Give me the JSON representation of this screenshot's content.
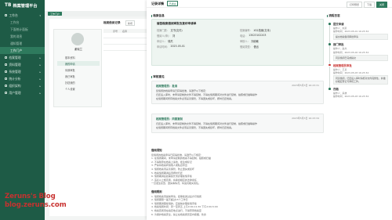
{
  "app": {
    "title": "档案管理平台",
    "logo_mark": "TB"
  },
  "sidebar": {
    "items": [
      {
        "label": "工作台",
        "icon": "home-icon",
        "level": 0,
        "chevron": "▾"
      },
      {
        "label": "工作台",
        "icon": "",
        "level": 1
      },
      {
        "label": "下面统计面板",
        "icon": "",
        "level": 1
      },
      {
        "label": "我的消息",
        "icon": "",
        "level": 1
      },
      {
        "label": "通知管理",
        "icon": "",
        "level": 1
      },
      {
        "label": "工作门户",
        "icon": "",
        "level": 1,
        "active": true
      },
      {
        "label": "档案管理",
        "icon": "folder-icon",
        "level": 0,
        "chevron": "▸"
      },
      {
        "label": "资料管理",
        "icon": "file-icon",
        "level": 0,
        "chevron": "▸"
      },
      {
        "label": "系统管理",
        "icon": "gear-icon",
        "level": 0,
        "chevron": "▸"
      },
      {
        "label": "统计分析",
        "icon": "chart-icon",
        "level": 0,
        "chevron": "▸"
      },
      {
        "label": "组织架构",
        "icon": "org-icon",
        "level": 0,
        "chevron": "▸"
      },
      {
        "label": "用户管理",
        "icon": "user-icon",
        "level": 0,
        "chevron": "▸"
      }
    ]
  },
  "tabs": {
    "active": "工作门户"
  },
  "background_page": {
    "user_name": "谢晓兰",
    "list_title": "档案借阅记录",
    "action_label": "新增",
    "tree": [
      "基本资料",
      "我的申请",
      "待我审批",
      "我已审批",
      "抄送我的",
      "个人设置"
    ],
    "columns": [
      "序号",
      "名称"
    ]
  },
  "drawer": {
    "title": "记录详情",
    "badge": "已通过",
    "buttons": {
      "print": "打印预览",
      "download": "下载",
      "close": "关闭"
    },
    "basic_section": "档案信息",
    "basic_title": "催告档案借阅审批及复印申请单",
    "fields": [
      {
        "k": "档案门类：",
        "v": "文书(文件)"
      },
      {
        "k": "档案编号：",
        "v": "XS1档案(文本)"
      },
      {
        "k": "借阅人(申)：",
        "v": "刘"
      },
      {
        "k": "电话：",
        "v": "13023102203"
      },
      {
        "k": "申请人：",
        "v": "徐杰"
      },
      {
        "k": "审核人：",
        "v": "刘增敏"
      },
      {
        "k": "申请时间：",
        "v": "2023-05-01"
      },
      {
        "k": "借阅类型：",
        "v": "借出"
      }
    ],
    "approval_section": "审核意见",
    "ops": [
      {
        "node": "档案管理员：",
        "result": "批准",
        "time": "2023年5月3日 16:23:31",
        "lines": [
          "您借阅的档案申请已获得批准，请遵守以下规定：",
          "归还后入库时，未申请复制的文件不得复制，不得在借阅期间对文件进行复制、拍照或扫描等操作",
          "在借阅期间所有档案文件必须妥善保管，不得遗失或损坏，按时归还档案。"
        ]
      },
      {
        "node": "档案管理员：",
        "result": "同意复制",
        "time": "2023年5月3日 16:23:34",
        "lines": [
          "归还后入库时，未申请复制的文件不得复制，不得在借阅期间对文件进行复制、拍照或扫描等操作",
          "在借阅期间所有档案文件必须妥善保管，不得遗失或损坏，按时归还档案。"
        ]
      }
    ],
    "notice_title": "借阅须知",
    "notice_lines": [
      "您借阅的档案申请已获得批准，请遵守以下规定：",
      "1. 在借阅期间，未申请复制的档案不得复制、拍照或扫描",
      "2. 不得随意在档案上涂改、批注或标记",
      "3. 严禁将档案转借他人或私自带出",
      "4. 借阅档案须妥善保管，防止遗失或损坏",
      "5. 档案借阅期满后须按时归还",
      "6. 借阅期满后如需延长须办理续借手续",
      "7. 违反以上规定者，将承担相应的法律责任",
      "一旦发生损毁、遗失等情况，将追究相关责任。"
    ],
    "rules_title": "借阅规则",
    "rules_lines": [
      "1. 借阅档案须提前申请，经审批通过后方可借阅",
      "2. 借阅期限一般不超过15个工作日",
      "3. 借阅期满需续借的，应提前办理续借手续",
      "4. 档案借阅时间：周一至周五 上午9:00-11:30 下午2:00-5:00",
      "5. 档案查阅须在指定地点进行，不得带离档案室",
      "6. 为保护档案安全，禁止在档案阅览室内吸烟、饮食"
    ],
    "flow_section": "流程日志",
    "flow": [
      {
        "name": "提交申请",
        "meta": [
          "操作人：刘某",
          "操作时间：2023-05-01 16:23:34"
        ],
        "note": "提交档案借阅审批申请",
        "red": false
      },
      {
        "name": "部门审批",
        "meta": [
          "操作人：赵杰",
          "操作时间：2023-05-02 16:23:34"
        ],
        "note": "同意借阅已完成提交",
        "red": false
      },
      {
        "name": "档案管理员审批",
        "meta": [
          "操作人：王某",
          "操作时间：2023-05-03 16:23:34"
        ],
        "note": "同意借阅，归还后入库时请核对文件完整性，并做好相应登记与审核工作。",
        "red": true
      },
      {
        "name": "归档",
        "meta": [
          "操作人：系统",
          "操作时间：2023-05-03 16:23:34"
        ],
        "note": "",
        "red": false
      }
    ]
  },
  "watermark": {
    "line1": "Zeruns's Blog",
    "line2": "blog.zeruns.com"
  }
}
